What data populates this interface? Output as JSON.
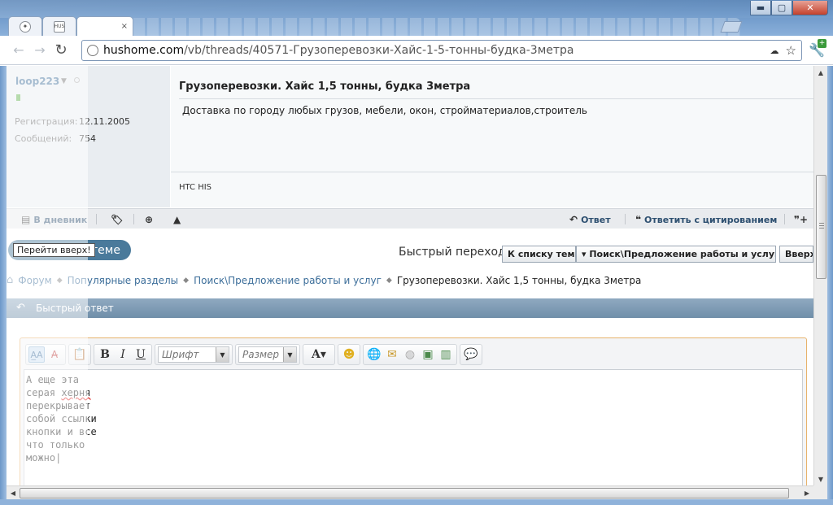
{
  "browser": {
    "tabs": [
      {
        "label": "",
        "icon": "mercedes-logo-icon"
      },
      {
        "label": "",
        "icon_text": "HUS"
      },
      {
        "label": "",
        "close": "×"
      }
    ],
    "window_controls": {
      "minimize": "▬",
      "maximize": "▢",
      "close": "✕"
    },
    "url_domain": "hushome.com",
    "url_path": "/vb/threads/40571-Грузоперевозки-Хайс-1-5-тонны-будка-3метра"
  },
  "post": {
    "username": "loop223",
    "reg_label": "Регистрация:",
    "reg_value": "12.11.2005",
    "posts_label": "Сообщений:",
    "posts_value": "754",
    "title": "Грузоперевозки. Хайс 1,5 тонны, будка 3метра",
    "text": "Доставка по городу любых грузов, мебели, окон, стройматериалов,строитель",
    "signature": "HTC HIS",
    "footer": {
      "diary": "В дневник",
      "reply": "Ответ",
      "reply_quote": "Ответить с цитированием"
    }
  },
  "nav": {
    "goto_top_tooltip": "Перейти вверх!",
    "pill_text": "теме",
    "quick_nav_label": "Быстрый переход",
    "btn_thread_list": "К списку тем",
    "btn_forum": "▾ Поиск\\Предложение работы и услуг",
    "btn_up": "Вверх"
  },
  "breadcrumbs": {
    "forum": "Форум",
    "popular": "Популярные разделы",
    "section": "Поиск\\Предложение работы и услуг",
    "current": "Грузоперевозки. Хайс 1,5 тонны, будка 3метра"
  },
  "quick_reply": {
    "title": "Быстрый ответ",
    "font_placeholder": "Шрифт",
    "size_placeholder": "Размер",
    "text_lines": [
      "А еще эта",
      "серая херня",
      "перекрывает",
      "собой ссылки",
      "кнопки и все",
      "что только",
      "можно"
    ]
  },
  "colors": {
    "accent": "#3c6e9a",
    "qr_bar": "#7f9cb6",
    "editor_border": "#e7b26b"
  }
}
